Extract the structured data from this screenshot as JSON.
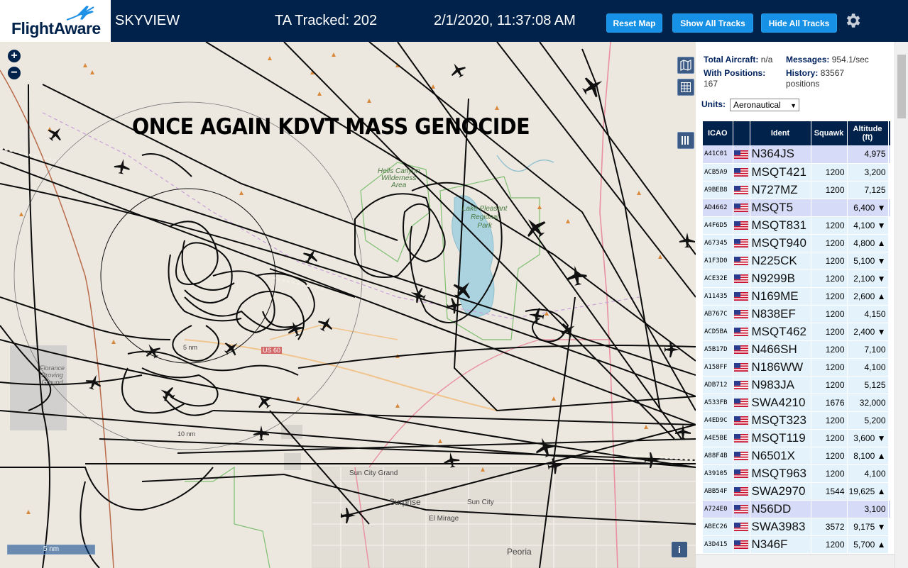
{
  "header": {
    "logo_text": "FlightAware",
    "site_name": "SKYVIEW",
    "tracked": "TA Tracked: 202",
    "datetime": "2/1/2020, 11:37:08 AM",
    "buttons": {
      "reset": "Reset Map",
      "show": "Show All Tracks",
      "hide": "Hide All Tracks"
    }
  },
  "map": {
    "banner": "ONCE AGAIN KDVT MASS GENOCIDE",
    "zoom_in": "+",
    "zoom_out": "−",
    "scale": "5 nm",
    "info": "i",
    "labels": {
      "hells_canyon": "Hells Canyon\nWilderness\nArea",
      "lake_pleasant": "Lake Pleasant\nRegional\nPark",
      "sun_city_grand": "Sun City Grand",
      "surprise": "Surprise",
      "sun_city": "Sun City",
      "el_mirage": "El Mirage",
      "peoria": "Peoria",
      "us60": "US 60",
      "yavapai": "Florance\nProving\nGround",
      "ring_10": "10 nm",
      "ring_5": "5 nm"
    }
  },
  "panel": {
    "total_aircraft_label": "Total Aircraft:",
    "total_aircraft_value": "n/a",
    "messages_label": "Messages:",
    "messages_value": "954.1/sec",
    "with_positions_label": "With Positions:",
    "with_positions_value": "167",
    "history_label": "History:",
    "history_value": "83567 positions",
    "units_label": "Units:",
    "units_value": "Aeronautical",
    "columns": {
      "icao": "ICAO",
      "ident": "Ident",
      "squawk": "Squawk",
      "altitude": "Altitude (ft)"
    }
  },
  "rows": [
    {
      "icao": "A41C01",
      "ident": "N364JS",
      "squawk": "",
      "alt": "4,975",
      "sel": true
    },
    {
      "icao": "ACB5A9",
      "ident": "MSQT421",
      "squawk": "1200",
      "alt": "3,200",
      "sel": false
    },
    {
      "icao": "A9BEB8",
      "ident": "N727MZ",
      "squawk": "1200",
      "alt": "7,125",
      "sel": false
    },
    {
      "icao": "AD4662",
      "ident": "MSQT5",
      "squawk": "",
      "alt": "6,400 ▼",
      "sel": true
    },
    {
      "icao": "A4F6D5",
      "ident": "MSQT831",
      "squawk": "1200",
      "alt": "4,100 ▼",
      "sel": false
    },
    {
      "icao": "A67345",
      "ident": "MSQT940",
      "squawk": "1200",
      "alt": "4,800 ▲",
      "sel": false
    },
    {
      "icao": "A1F3D0",
      "ident": "N225CK",
      "squawk": "1200",
      "alt": "5,100 ▼",
      "sel": false
    },
    {
      "icao": "ACE32E",
      "ident": "N9299B",
      "squawk": "1200",
      "alt": "2,100 ▼",
      "sel": false
    },
    {
      "icao": "A11435",
      "ident": "N169ME",
      "squawk": "1200",
      "alt": "2,600 ▲",
      "sel": false
    },
    {
      "icao": "AB767C",
      "ident": "N838EF",
      "squawk": "1200",
      "alt": "4,150",
      "sel": false
    },
    {
      "icao": "ACD5BA",
      "ident": "MSQT462",
      "squawk": "1200",
      "alt": "2,400 ▼",
      "sel": false
    },
    {
      "icao": "A5B17D",
      "ident": "N466SH",
      "squawk": "1200",
      "alt": "7,100",
      "sel": false
    },
    {
      "icao": "A158FF",
      "ident": "N186WW",
      "squawk": "1200",
      "alt": "4,100",
      "sel": false
    },
    {
      "icao": "ADB712",
      "ident": "N983JA",
      "squawk": "1200",
      "alt": "5,125",
      "sel": false
    },
    {
      "icao": "A533FB",
      "ident": "SWA4210",
      "squawk": "1676",
      "alt": "32,000",
      "sel": false
    },
    {
      "icao": "A4ED9C",
      "ident": "MSQT323",
      "squawk": "1200",
      "alt": "5,200",
      "sel": false
    },
    {
      "icao": "A4E5BE",
      "ident": "MSQT119",
      "squawk": "1200",
      "alt": "3,600 ▼",
      "sel": false
    },
    {
      "icao": "A88F4B",
      "ident": "N6501X",
      "squawk": "1200",
      "alt": "8,100 ▲",
      "sel": false
    },
    {
      "icao": "A39105",
      "ident": "MSQT963",
      "squawk": "1200",
      "alt": "4,100",
      "sel": false
    },
    {
      "icao": "ABB54F",
      "ident": "SWA2970",
      "squawk": "1544",
      "alt": "19,625 ▲",
      "sel": false
    },
    {
      "icao": "A724E0",
      "ident": "N56DD",
      "squawk": "",
      "alt": "3,100",
      "sel": true
    },
    {
      "icao": "ABEC26",
      "ident": "SWA3983",
      "squawk": "3572",
      "alt": "9,175 ▼",
      "sel": false
    },
    {
      "icao": "A3D415",
      "ident": "N346F",
      "squawk": "1200",
      "alt": "5,700 ▲",
      "sel": false
    }
  ],
  "colors": {
    "header_bg": "#00224b",
    "button_bg": "#1691e6",
    "row_bg": "#e3f2fb",
    "row_selected_bg": "#d6dcf7"
  }
}
